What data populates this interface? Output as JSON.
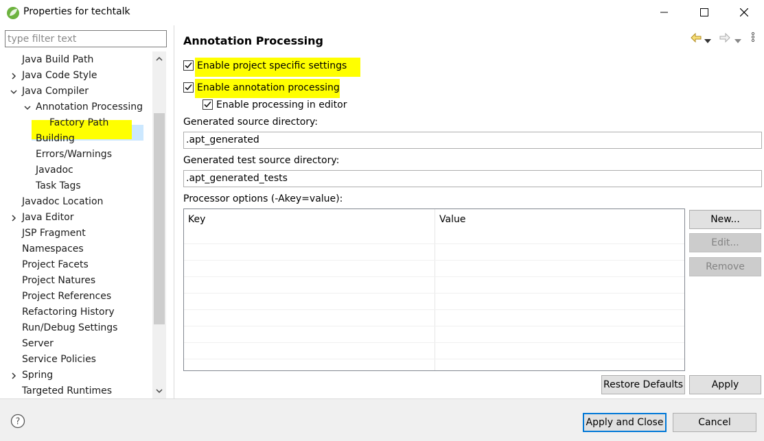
{
  "window": {
    "title": "Properties for techtalk",
    "controls": {
      "minimize": "minimize-icon",
      "maximize": "maximize-icon",
      "close": "close-icon"
    }
  },
  "filter": {
    "placeholder": "type filter text"
  },
  "tree": [
    {
      "label": "Java Build Path",
      "level": 1,
      "twisty": "none"
    },
    {
      "label": "Java Code Style",
      "level": 1,
      "twisty": "collapsed"
    },
    {
      "label": "Java Compiler",
      "level": 1,
      "twisty": "expanded"
    },
    {
      "label": "Annotation Processing",
      "level": 2,
      "twisty": "expanded",
      "selected": true
    },
    {
      "label": "Factory Path",
      "level": 3,
      "twisty": "none"
    },
    {
      "label": "Building",
      "level": 2,
      "twisty": "none"
    },
    {
      "label": "Errors/Warnings",
      "level": 2,
      "twisty": "none"
    },
    {
      "label": "Javadoc",
      "level": 2,
      "twisty": "none"
    },
    {
      "label": "Task Tags",
      "level": 2,
      "twisty": "none"
    },
    {
      "label": "Javadoc Location",
      "level": 1,
      "twisty": "none"
    },
    {
      "label": "Java Editor",
      "level": 1,
      "twisty": "collapsed"
    },
    {
      "label": "JSP Fragment",
      "level": 1,
      "twisty": "none"
    },
    {
      "label": "Namespaces",
      "level": 1,
      "twisty": "none"
    },
    {
      "label": "Project Facets",
      "level": 1,
      "twisty": "none"
    },
    {
      "label": "Project Natures",
      "level": 1,
      "twisty": "none"
    },
    {
      "label": "Project References",
      "level": 1,
      "twisty": "none"
    },
    {
      "label": "Refactoring History",
      "level": 1,
      "twisty": "none"
    },
    {
      "label": "Run/Debug Settings",
      "level": 1,
      "twisty": "none"
    },
    {
      "label": "Server",
      "level": 1,
      "twisty": "none"
    },
    {
      "label": "Service Policies",
      "level": 1,
      "twisty": "none"
    },
    {
      "label": "Spring",
      "level": 1,
      "twisty": "collapsed"
    },
    {
      "label": "Targeted Runtimes",
      "level": 1,
      "twisty": "none"
    }
  ],
  "page": {
    "title": "Annotation Processing",
    "enable_project_specific": {
      "label": "Enable project specific settings",
      "checked": true
    },
    "enable_annotation_processing": {
      "label": "Enable annotation processing",
      "checked": true
    },
    "enable_in_editor": {
      "label": "Enable processing in editor",
      "checked": true
    },
    "generated_source_dir": {
      "label": "Generated source directory:",
      "value": ".apt_generated"
    },
    "generated_test_source_dir": {
      "label": "Generated test source directory:",
      "value": ".apt_generated_tests"
    },
    "processor_options": {
      "label": "Processor options (-Akey=value):",
      "columns": [
        "Key",
        "Value"
      ],
      "rows": []
    },
    "buttons": {
      "new": "New...",
      "edit": "Edit...",
      "remove": "Remove",
      "restore_defaults": "Restore Defaults",
      "apply": "Apply"
    }
  },
  "footer": {
    "apply_and_close": "Apply and Close",
    "cancel": "Cancel"
  },
  "colors": {
    "highlight": "#ffff00",
    "selection": "#cce8ff",
    "accent": "#0078d7"
  }
}
